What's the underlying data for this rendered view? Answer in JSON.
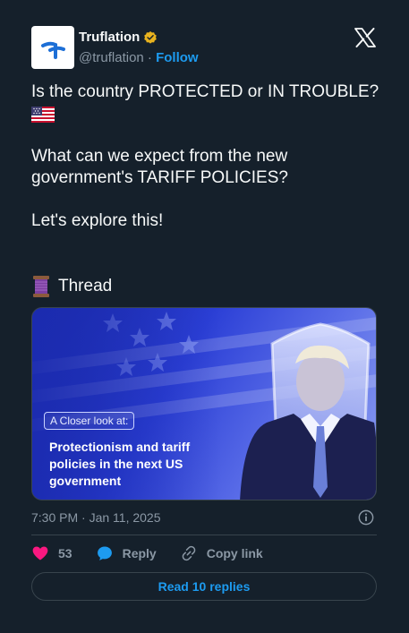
{
  "author": {
    "display_name": "Truflation",
    "handle": "@truflation",
    "separator": " · ",
    "follow_label": "Follow",
    "verified": true,
    "verified_color": "#e8b21e"
  },
  "tweet": {
    "line1": "Is the country PROTECTED or IN TROUBLE?",
    "flag_icon": "us-flag-icon",
    "line2": "What can we expect from the new government's TARIFF POLICIES?",
    "line3": "Let's explore this!",
    "thread_label": "Thread",
    "thread_icon": "spool-of-thread-icon"
  },
  "media": {
    "pill_text": "A Closer look at:",
    "headline": "Protectionism and tariff policies in the next US government"
  },
  "meta": {
    "timestamp": "7:30 PM · Jan 11, 2025"
  },
  "actions": {
    "like_count": "53",
    "reply_label": "Reply",
    "copy_label": "Copy link"
  },
  "replies_button": "Read 10 replies",
  "colors": {
    "background": "#15202b",
    "accent": "#1d9bf0",
    "like": "#f91880",
    "muted": "#8b98a5",
    "border": "#38444d"
  }
}
